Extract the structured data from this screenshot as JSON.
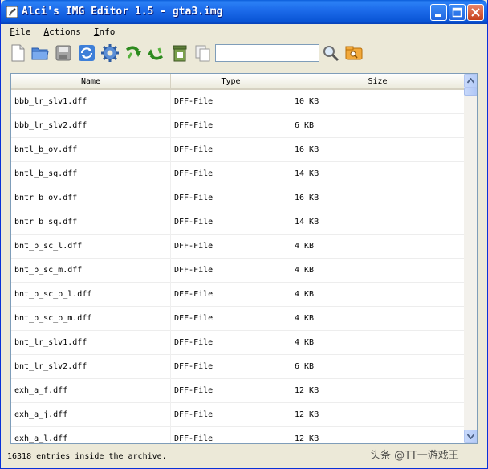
{
  "window": {
    "title": "Alci's IMG Editor 1.5 - gta3.img"
  },
  "menu": [
    {
      "label": "File"
    },
    {
      "label": "Actions"
    },
    {
      "label": "Info"
    }
  ],
  "toolbar": {
    "icons": [
      "new-file-icon",
      "open-folder-icon",
      "save-icon",
      "refresh-icon",
      "settings-gear-icon",
      "import-arrow-icon",
      "export-arrow-icon",
      "delete-bin-icon",
      "copy-icon",
      "search-icon",
      "open-archive-icon"
    ],
    "search": {
      "value": "",
      "placeholder": ""
    }
  },
  "list": {
    "columns": [
      "Name",
      "Type",
      "Size"
    ],
    "rows": [
      {
        "name": "bbb_lr_slv1.dff",
        "type": "DFF-File",
        "size": "10 KB"
      },
      {
        "name": "bbb_lr_slv2.dff",
        "type": "DFF-File",
        "size": "6 KB"
      },
      {
        "name": "bntl_b_ov.dff",
        "type": "DFF-File",
        "size": "16 KB"
      },
      {
        "name": "bntl_b_sq.dff",
        "type": "DFF-File",
        "size": "14 KB"
      },
      {
        "name": "bntr_b_ov.dff",
        "type": "DFF-File",
        "size": "16 KB"
      },
      {
        "name": "bntr_b_sq.dff",
        "type": "DFF-File",
        "size": "14 KB"
      },
      {
        "name": "bnt_b_sc_l.dff",
        "type": "DFF-File",
        "size": "4 KB"
      },
      {
        "name": "bnt_b_sc_m.dff",
        "type": "DFF-File",
        "size": "4 KB"
      },
      {
        "name": "bnt_b_sc_p_l.dff",
        "type": "DFF-File",
        "size": "4 KB"
      },
      {
        "name": "bnt_b_sc_p_m.dff",
        "type": "DFF-File",
        "size": "4 KB"
      },
      {
        "name": "bnt_lr_slv1.dff",
        "type": "DFF-File",
        "size": "4 KB"
      },
      {
        "name": "bnt_lr_slv2.dff",
        "type": "DFF-File",
        "size": "6 KB"
      },
      {
        "name": "exh_a_f.dff",
        "type": "DFF-File",
        "size": "12 KB"
      },
      {
        "name": "exh_a_j.dff",
        "type": "DFF-File",
        "size": "12 KB"
      },
      {
        "name": "exh_a_l.dff",
        "type": "DFF-File",
        "size": "12 KB"
      }
    ]
  },
  "status": {
    "text": "16318 entries inside the archive."
  },
  "watermark": {
    "text": "头条 @TT一游戏王"
  }
}
